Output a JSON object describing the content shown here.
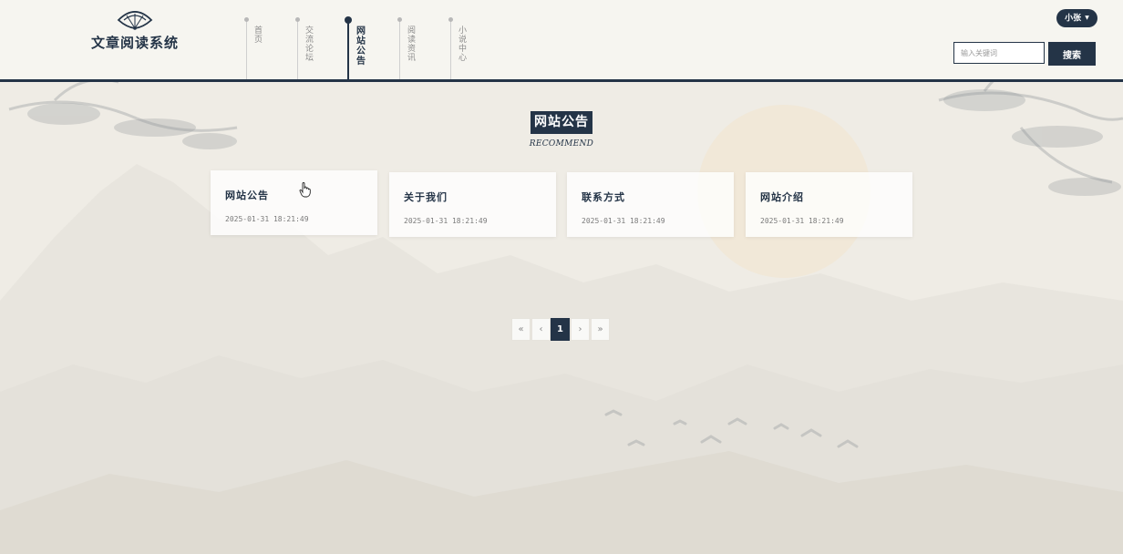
{
  "header": {
    "logo_text": "文章阅读系统",
    "nav": [
      {
        "label": "首页",
        "active": false
      },
      {
        "label": "交流论坛",
        "active": false
      },
      {
        "label": "网站公告",
        "active": true
      },
      {
        "label": "阅读资讯",
        "active": false
      },
      {
        "label": "小说中心",
        "active": false
      }
    ],
    "user_name": "小张",
    "search_placeholder": "输入关键词",
    "search_button": "搜索"
  },
  "section": {
    "title": "网站公告",
    "subtitle": "RECOMMEND"
  },
  "cards": [
    {
      "title": "网站公告",
      "date": "2025-01-31 18:21:49"
    },
    {
      "title": "关于我们",
      "date": "2025-01-31 18:21:49"
    },
    {
      "title": "联系方式",
      "date": "2025-01-31 18:21:49"
    },
    {
      "title": "网站介绍",
      "date": "2025-01-31 18:21:49"
    }
  ],
  "pagination": {
    "first": "«",
    "prev": "‹",
    "current": "1",
    "next": "›",
    "last": "»"
  },
  "colors": {
    "primary": "#243447",
    "page_bg": "#efece5",
    "header_bg": "#f6f5f0"
  }
}
